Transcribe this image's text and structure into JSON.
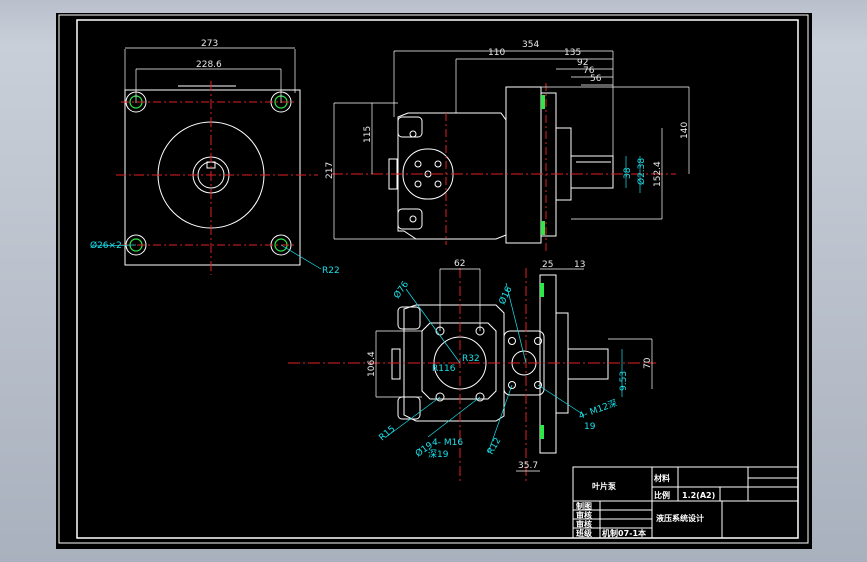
{
  "drawing": {
    "front_view": {
      "dimensions": [
        "273",
        "228.6"
      ],
      "hole_callout": "Ø26×2",
      "radius_label": "R22"
    },
    "side_view": {
      "dimensions_top": [
        "354",
        "110",
        "135",
        "92",
        "76",
        "56"
      ],
      "dimensions_left": [
        "115",
        "217"
      ],
      "dimensions_right": [
        "140",
        "38",
        "Ø2.38",
        "152.4"
      ]
    },
    "bottom_view": {
      "dimensions_top": [
        "62",
        "25",
        "13"
      ],
      "dimensions_left": [
        "106.4"
      ],
      "dimensions_right": [
        "70",
        "9.53"
      ],
      "dimensions_bottom": [
        "35.7"
      ],
      "labels": [
        "Ø76",
        "R116",
        "R32",
        "Ø16",
        "R12",
        "R15",
        "Ø19",
        "4- M16",
        "深19",
        "4- M12深",
        "19"
      ]
    },
    "title_block": {
      "part_name": "叶片泵",
      "material_label": "材料",
      "scale_label": "比例",
      "scale_value": "1.2(A2)",
      "rows": [
        "制图",
        "审核",
        "审核",
        "班级"
      ],
      "class_value": "机制07-1本",
      "project_title": "液压系统设计"
    }
  }
}
